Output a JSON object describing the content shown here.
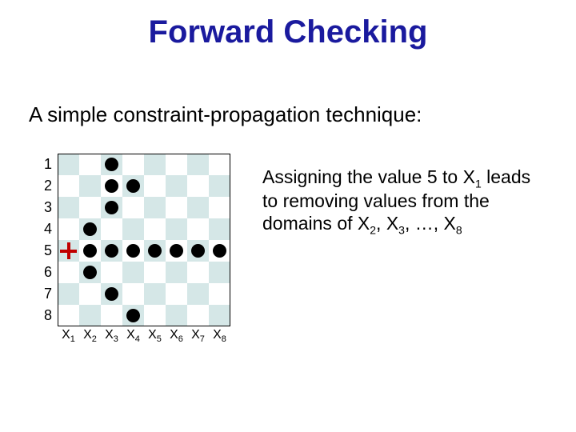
{
  "title": "Forward Checking",
  "subtitle": "A simple constraint-propagation technique:",
  "board": {
    "size": 8,
    "row_labels": [
      "1",
      "2",
      "3",
      "4",
      "5",
      "6",
      "7",
      "8"
    ],
    "col_labels": [
      "X₁",
      "X₂",
      "X₃",
      "X₄",
      "X₅",
      "X₆",
      "X₇",
      "X₈"
    ],
    "marker": {
      "type": "cross",
      "col": 1,
      "row": 5,
      "color": "#c00000"
    },
    "dots": [
      {
        "col": 3,
        "row": 1
      },
      {
        "col": 3,
        "row": 2
      },
      {
        "col": 4,
        "row": 2
      },
      {
        "col": 3,
        "row": 3
      },
      {
        "col": 2,
        "row": 4
      },
      {
        "col": 2,
        "row": 5
      },
      {
        "col": 3,
        "row": 5
      },
      {
        "col": 4,
        "row": 5
      },
      {
        "col": 5,
        "row": 5
      },
      {
        "col": 6,
        "row": 5
      },
      {
        "col": 7,
        "row": 5
      },
      {
        "col": 8,
        "row": 5
      },
      {
        "col": 2,
        "row": 6
      },
      {
        "col": 3,
        "row": 7
      },
      {
        "col": 4,
        "row": 8
      }
    ]
  },
  "blurb": {
    "line1": "Assigning the value 5 to X",
    "sub1": "1",
    "line2": " leads to removing values from the domains of X",
    "sub2": "2",
    "mid": ", X",
    "sub3": "3",
    "tail": ", …, X",
    "sub4": "8"
  }
}
